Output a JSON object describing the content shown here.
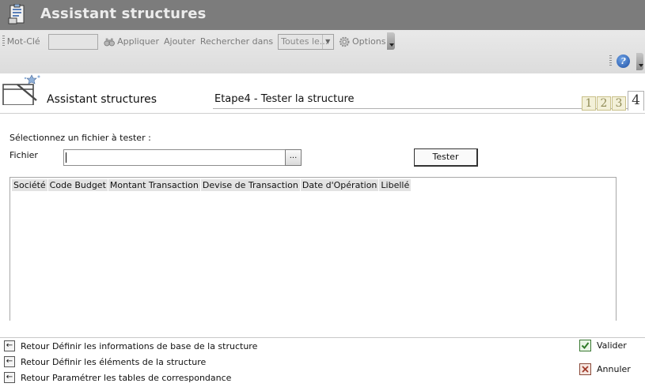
{
  "app": {
    "title": "Assistant structures"
  },
  "toolbar": {
    "keyword_label": "Mot-Clé",
    "keyword_value": "",
    "apply_label": "Appliquer",
    "add_label": "Ajouter",
    "search_in_label": "Rechercher dans",
    "scope_value": "Toutes le...",
    "options_label": "Options",
    "options_arrow": "▾",
    "help_glyph": "?"
  },
  "wizard": {
    "title": "Assistant structures",
    "step_title": "Etape4 - Tester la structure",
    "steps": [
      "1",
      "2",
      "3",
      "4"
    ],
    "active_step": "4"
  },
  "form": {
    "select_prompt": "Sélectionnez un fichier à tester :",
    "file_label": "Fichier",
    "file_value": "",
    "browse_label": "...",
    "test_button": "Tester"
  },
  "grid": {
    "columns": [
      "Société",
      "Code Budget",
      "Montant Transaction",
      "Devise de Transaction",
      "Date d'Opération",
      "Libellé"
    ],
    "rows": []
  },
  "footer": {
    "back_glyph": "←",
    "back_links": [
      "Retour Définir les informations de base de la structure",
      "Retour Définir les éléments de la structure",
      "Retour Paramétrer les tables de correspondance"
    ],
    "validate_label": "Valider",
    "cancel_label": "Annuler"
  },
  "colors": {
    "titlebar": "#7c7c7c",
    "title_text": "#ececec",
    "step_tab": "#f3f0d8",
    "validate_green": "#3c7a34",
    "cancel_red": "#a03a2a"
  }
}
